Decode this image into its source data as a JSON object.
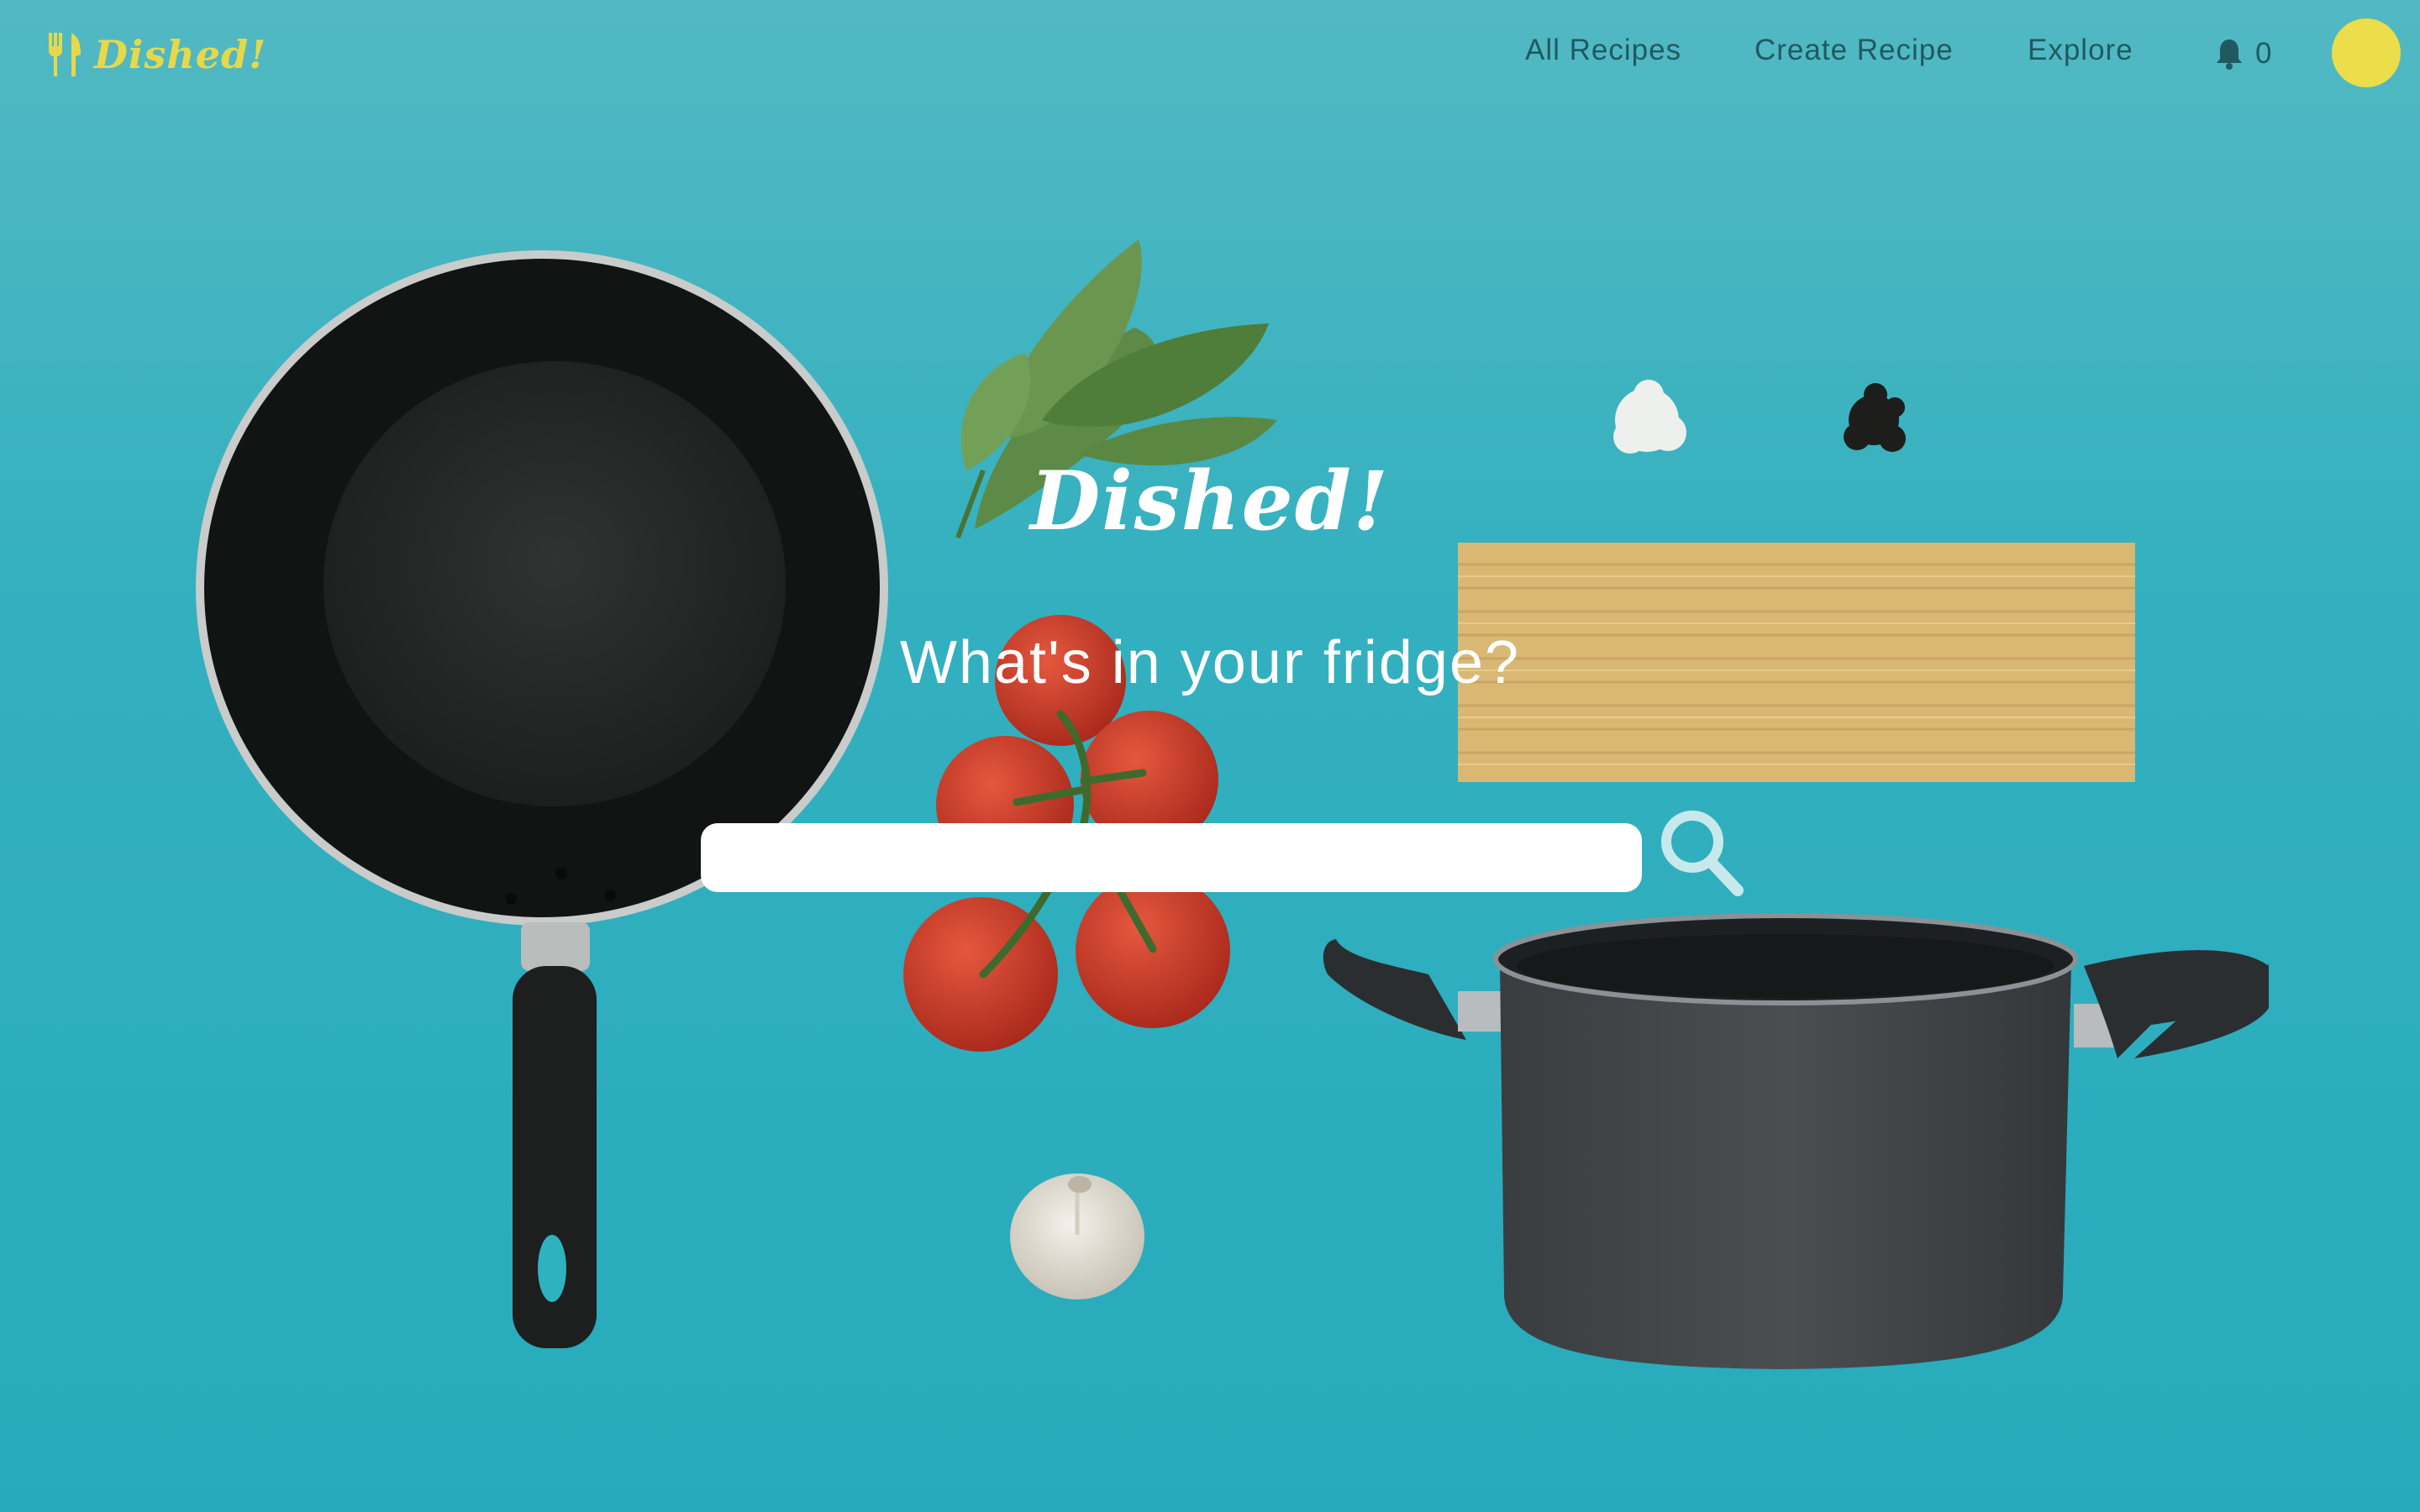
{
  "app": {
    "brand": "Dished!",
    "brand_color": "#e7d84a",
    "brand_icon": "fork-knife-icon"
  },
  "nav": {
    "links": [
      {
        "label": "All Recipes"
      },
      {
        "label": "Create Recipe"
      },
      {
        "label": "Explore"
      }
    ],
    "notifications": {
      "icon": "bell-icon",
      "count": "0"
    },
    "avatar_color": "#ecdd4a"
  },
  "hero": {
    "logo": "Dished!",
    "question": "What's in your fridge?",
    "search": {
      "value": "",
      "placeholder": ""
    },
    "search_icon": "search-icon"
  },
  "colors": {
    "background": "#2eb2c0",
    "nav_text": "#1f5a61",
    "hero_text": "#ffffff"
  }
}
